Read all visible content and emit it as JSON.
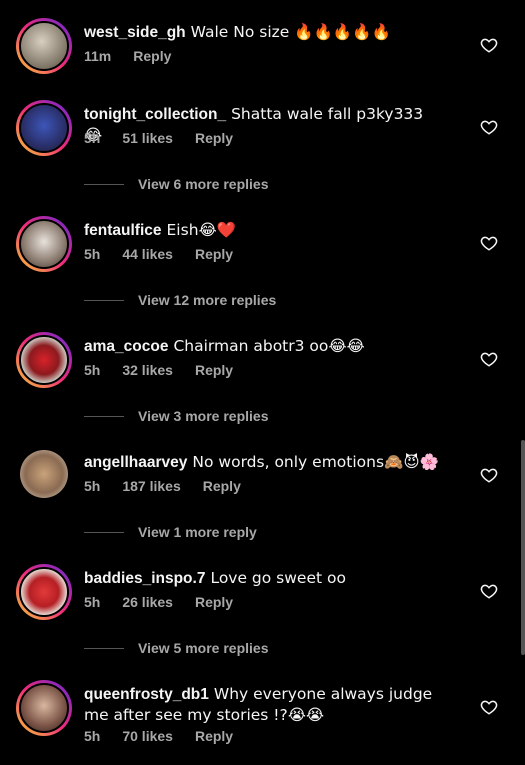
{
  "comments": [
    {
      "username": "west_side_gh",
      "text": "Wale No size 🔥🔥🔥🔥🔥",
      "time": "11m",
      "likes": "",
      "reply": "Reply",
      "view_replies": "",
      "avatar": "avatar-1"
    },
    {
      "username": "tonight_collection_",
      "text": "Shatta wale fall p3ky333 😂",
      "time": "5h",
      "likes": "51 likes",
      "reply": "Reply",
      "view_replies": "View 6 more replies",
      "avatar": "avatar-2"
    },
    {
      "username": "fentaulfice",
      "text": "Eish😂❤️",
      "time": "5h",
      "likes": "44 likes",
      "reply": "Reply",
      "view_replies": "View 12 more replies",
      "avatar": "avatar-3"
    },
    {
      "username": "ama_cocoe",
      "text": "Chairman abotr3 oo😂😂",
      "time": "5h",
      "likes": "32 likes",
      "reply": "Reply",
      "view_replies": "View 3 more replies",
      "avatar": "avatar-4"
    },
    {
      "username": "angellhaarvey",
      "text": "No words, only emotions🙈😈🌸",
      "time": "5h",
      "likes": "187 likes",
      "reply": "Reply",
      "view_replies": "View 1 more reply",
      "avatar": "avatar-5"
    },
    {
      "username": "baddies_inspo.7",
      "text": "Love go sweet oo",
      "time": "5h",
      "likes": "26 likes",
      "reply": "Reply",
      "view_replies": "View 5 more replies",
      "avatar": "avatar-6"
    },
    {
      "username": "queenfrosty_db1",
      "text": "Why everyone always judge me after see my stories !?😭😭",
      "time": "5h",
      "likes": "70 likes",
      "reply": "Reply",
      "view_replies": "",
      "avatar": "avatar-7"
    }
  ],
  "icons": {
    "like": "heart-outline-icon"
  },
  "colors": {
    "background": "#000000",
    "secondary_text": "#a8a8a8",
    "story_ring": "#ee2a7b"
  }
}
